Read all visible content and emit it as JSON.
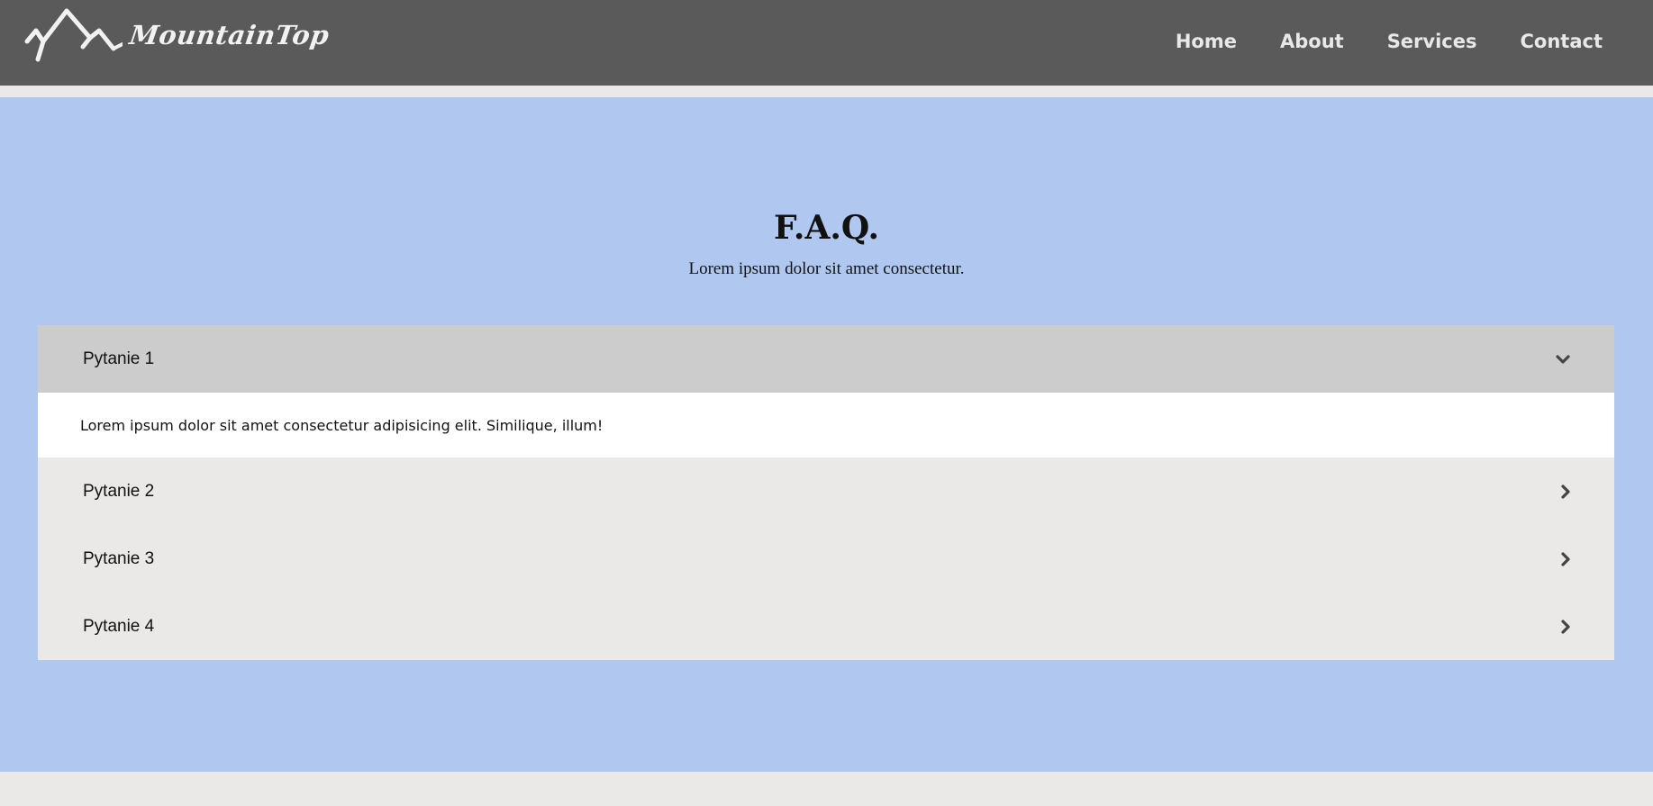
{
  "header": {
    "logo_text": "MountainTop",
    "nav": [
      {
        "label": "Home"
      },
      {
        "label": "About"
      },
      {
        "label": "Services"
      },
      {
        "label": "Contact"
      }
    ]
  },
  "faq": {
    "title": "F.A.Q.",
    "subtitle": "Lorem ipsum dolor sit amet consectetur.",
    "items": [
      {
        "question": "Pytanie 1",
        "answer": "Lorem ipsum dolor sit amet consectetur adipisicing elit. Similique, illum!",
        "expanded": true,
        "icon": "chevron-down-icon"
      },
      {
        "question": "Pytanie 2",
        "expanded": false,
        "icon": "chevron-right-icon"
      },
      {
        "question": "Pytanie 3",
        "expanded": false,
        "icon": "chevron-right-icon"
      },
      {
        "question": "Pytanie 4",
        "expanded": false,
        "icon": "chevron-right-icon"
      }
    ]
  },
  "colors": {
    "navbar_bg": "#5a5a5a",
    "section_bg": "#b0c8f0",
    "page_bg": "#ebe9e7",
    "open_header_bg": "#cccccc",
    "answer_bg": "#ffffff"
  }
}
